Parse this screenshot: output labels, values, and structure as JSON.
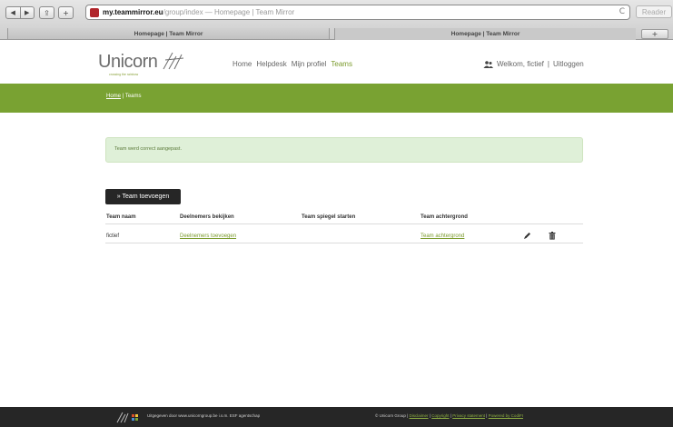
{
  "browser": {
    "nav_back": "◀",
    "nav_forward": "▶",
    "share_label": "⇪",
    "add_label": "+",
    "url_domain": "my.teammirror.eu",
    "url_path": "/group/index — Homepage | Team Mirror",
    "reload_label": "C",
    "reader_label": "Reader",
    "tabs": [
      {
        "label": "Homepage | Team Mirror",
        "active": true
      },
      {
        "label": "Homepage | Team Mirror",
        "active": false
      }
    ],
    "new_tab_label": "+"
  },
  "header": {
    "logo_text": "Unicorn",
    "logo_tagline": "crossing the rainbow",
    "nav": [
      {
        "label": "Home",
        "active": false
      },
      {
        "label": "Helpdesk",
        "active": false
      },
      {
        "label": "Mijn profiel",
        "active": false
      },
      {
        "label": "Teams",
        "active": true
      }
    ],
    "welcome": "Welkom, fictief",
    "separator": "|",
    "logout": "Uitloggen"
  },
  "breadcrumb": {
    "home": "Home",
    "separator": "|",
    "current": "Teams"
  },
  "alert": {
    "message": "Team werd correct aangepast."
  },
  "actions": {
    "add_team": "» Team toevoegen"
  },
  "table": {
    "headers": [
      "Team naam",
      "Deelnemers bekijken",
      "Team spiegel starten",
      "Team achtergrond"
    ],
    "rows": [
      {
        "name": "fictief",
        "participants": "Deelnemers toevoegen",
        "mirror": "",
        "background": "Team achtergrond"
      }
    ]
  },
  "footer": {
    "left_text": "Uitgegeven door www.unicorngroup.be i.s.m. ESF agentschap",
    "copyright": "© Unicorn Group |",
    "links": [
      "Disclaimer",
      "Copyright",
      "Privacy statement",
      "Powered by CodiFI"
    ],
    "separator": "|"
  },
  "colors": {
    "accent_green": "#79a232",
    "link_green": "#7a9a2b",
    "footer_bg": "#262626",
    "alert_bg": "#dff0d8"
  }
}
